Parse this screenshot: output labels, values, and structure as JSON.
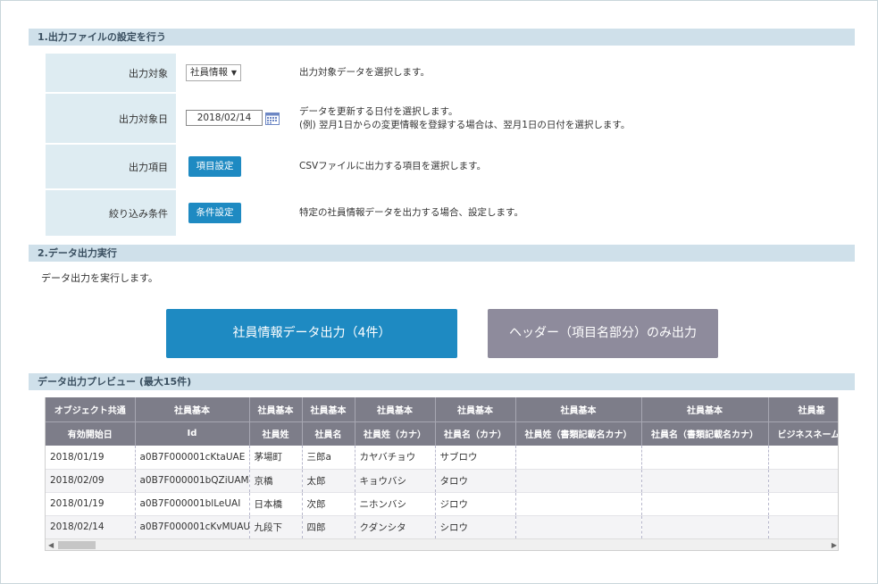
{
  "section1": {
    "title": "1.出力ファイルの設定を行う",
    "rows": [
      {
        "label": "出力対象",
        "desc": [
          "出力対象データを選択します。"
        ]
      },
      {
        "label": "出力対象日",
        "desc": [
          "データを更新する日付を選択します。",
          "(例) 翌月1日からの変更情報を登録する場合は、翌月1日の日付を選択します。"
        ]
      },
      {
        "label": "出力項目",
        "desc": [
          "CSVファイルに出力する項目を選択します。"
        ]
      },
      {
        "label": "絞り込み条件",
        "desc": [
          "特定の社員情報データを出力する場合、設定します。"
        ]
      }
    ],
    "target_select": {
      "value": "社員情報",
      "arrow": "▼"
    },
    "date_value": "2018/02/14",
    "item_button": "項目設定",
    "filter_button": "条件設定"
  },
  "section2": {
    "title": "2.データ出力実行",
    "desc": "データ出力を実行します。",
    "export_button": "社員情報データ出力（4件）",
    "header_button": "ヘッダー（項目名部分）のみ出力"
  },
  "preview": {
    "title": "データ出力プレビュー (最大15件)",
    "header_row1": [
      "オブジェクト共通",
      "社員基本",
      "社員基本",
      "社員基本",
      "社員基本",
      "社員基本",
      "社員基本",
      "社員基本",
      "社員基"
    ],
    "header_row2": [
      "有効開始日",
      "Id",
      "社員姓",
      "社員名",
      "社員姓（カナ）",
      "社員名（カナ）",
      "社員姓（書類記載名カナ）",
      "社員名（書類記載名カナ）",
      "ビジネスネーム"
    ],
    "rows": [
      [
        "2018/01/19",
        "a0B7F000001cKtaUAE",
        "茅場町",
        "三郎a",
        "カヤバチョウ",
        "サブロウ",
        "",
        "",
        ""
      ],
      [
        "2018/02/09",
        "a0B7F000001bQZiUAM",
        "京橋",
        "太郎",
        "キョウバシ",
        "タロウ",
        "",
        "",
        ""
      ],
      [
        "2018/01/19",
        "a0B7F000001blLeUAI",
        "日本橋",
        "次郎",
        "ニホンバシ",
        "ジロウ",
        "",
        "",
        ""
      ],
      [
        "2018/02/14",
        "a0B7F000001cKvMUAU",
        "九段下",
        "四郎",
        "クダンシタ",
        "シロウ",
        "",
        "",
        ""
      ]
    ]
  },
  "colors": {
    "section_header_bg": "#cfe0ea",
    "label_bg": "#deecf2",
    "primary_button": "#1e8ac2",
    "secondary_button": "#8e8b9c",
    "table_header": "#7d7d89"
  },
  "icons": {
    "calendar": "calendar-icon",
    "scroll_left": "◀",
    "scroll_right": "▶"
  }
}
